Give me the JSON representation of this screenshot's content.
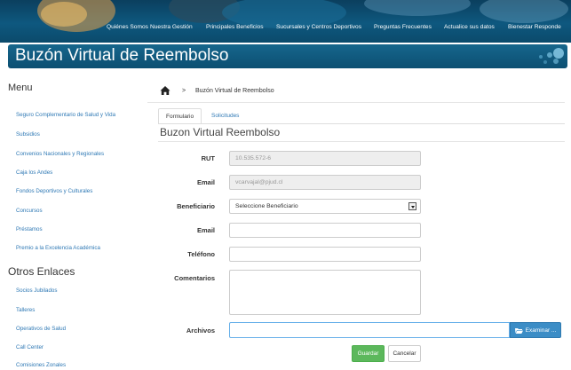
{
  "top_nav": {
    "links": [
      "Quiénes Somos",
      "Nuestra Gestión",
      "Principales Beneficios",
      "Sucursales y Centros Deportivos",
      "Preguntas Frecuentes",
      "Actualice sus datos",
      "Bienestar Responde"
    ]
  },
  "banner": {
    "title": "Buzón Virtual de Reembolso"
  },
  "sidebar": {
    "menu_heading": "Menu",
    "menu_items": [
      "Seguro Complementario de Salud y Vida",
      "Subsidios",
      "Convenios Nacionales y Regionales",
      "Caja los Andes",
      "Fondos Deportivos y Culturales",
      "Concursos",
      "Préstamos",
      "Premio a la Excelencia Académica"
    ],
    "others_heading": "Otros Enlaces",
    "other_items": [
      "Socios Jubilados",
      "Talleres",
      "Operativos de Salud",
      "Call Center",
      "Comisiones Zonales"
    ]
  },
  "breadcrumb": {
    "separator": ">",
    "current": "Buzón Virtual de Reembolso"
  },
  "tabs": [
    {
      "label": "Formulario"
    },
    {
      "label": "Solicitudes"
    }
  ],
  "form": {
    "title": "Buzon Virtual Reembolso",
    "rut_label": "RUT",
    "rut_value": "10.535.572-6",
    "email_label": "Email",
    "email_value": "vcarvajal@pjud.cl",
    "beneficiario_label": "Beneficiario",
    "beneficiario_selected": "Seleccione Beneficiario",
    "email2_label": "Email",
    "email2_value": "",
    "telefono_label": "Teléfono",
    "telefono_value": "",
    "comentarios_label": "Comentarios",
    "comentarios_value": "",
    "archivos_label": "Archivos",
    "browse_label": "Examinar ...",
    "save_label": "Guardar",
    "cancel_label": "Cancelar"
  },
  "colors": {
    "nav_bg": "#0e587f",
    "link": "#2f79b5",
    "primary": "#3c8dc6",
    "success": "#5cb85c"
  },
  "icons": {
    "home": "home-icon",
    "select_caret": "chevron-down-icon",
    "folder": "folder-open-icon"
  }
}
